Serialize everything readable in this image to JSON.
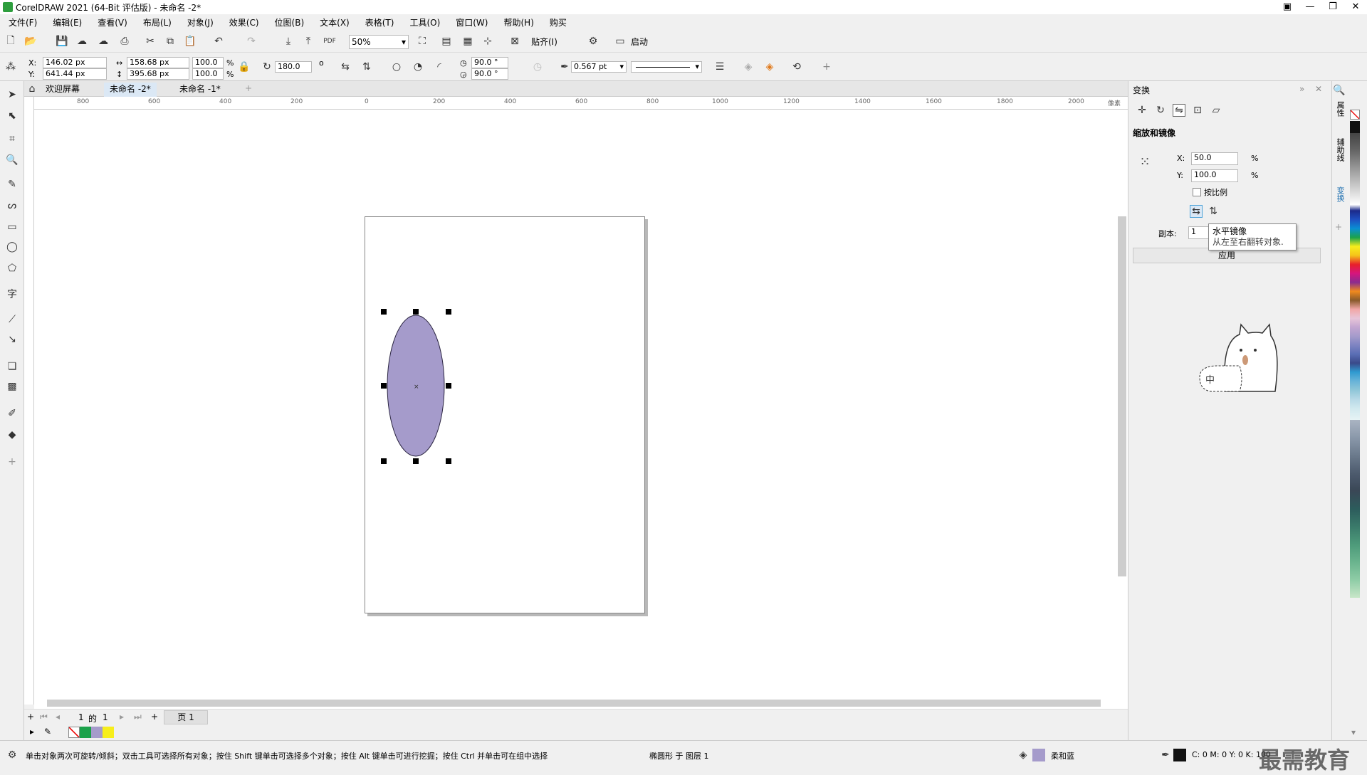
{
  "window": {
    "title": "CorelDRAW 2021 (64-Bit 评估版) - 未命名 -2*"
  },
  "menu": [
    "文件(F)",
    "编辑(E)",
    "查看(V)",
    "布局(L)",
    "对象(J)",
    "效果(C)",
    "位图(B)",
    "文本(X)",
    "表格(T)",
    "工具(O)",
    "窗口(W)",
    "帮助(H)",
    "购买"
  ],
  "toolbar": {
    "zoom": "50%",
    "snap": "贴齐(I)",
    "launch": "启动"
  },
  "props": {
    "x": "146.02 px",
    "y": "641.44 px",
    "w": "158.68 px",
    "h": "395.68 px",
    "sx": "100.0",
    "sy": "100.0",
    "pct": "%",
    "rot": "180.0",
    "deg": "o",
    "ang1": "90.0 °",
    "ang2": "90.0 °",
    "outline": "0.567 pt"
  },
  "tabs": {
    "welcome": "欢迎屏幕",
    "doc2": "未命名 -2*",
    "doc1": "未命名 -1*"
  },
  "ruler": {
    "ticks": [
      "800",
      "600",
      "400",
      "200",
      "0",
      "200",
      "400",
      "600",
      "800",
      "1000",
      "1200",
      "1400",
      "1600",
      "1800",
      "2000"
    ],
    "unit": "像素"
  },
  "pagebar": {
    "current": "1",
    "of": "的",
    "total": "1",
    "page_tab": "页 1"
  },
  "docker": {
    "title": "变换",
    "section": "缩放和镜像",
    "x_label": "X:",
    "x_value": "50.0",
    "y_label": "Y:",
    "y_value": "100.0",
    "pct": "%",
    "proportional": "按比例",
    "copies_label": "副本:",
    "copies_value": "1",
    "apply": "应用",
    "tooltip_title": "水平镜像",
    "tooltip_desc": "从左至右翻转对象."
  },
  "docktabs": {
    "props": "属性",
    "guides": "辅助线",
    "transform": "变换"
  },
  "status": {
    "hint": "单击对象两次可旋转/倾斜；双击工具可选择所有对象；按住 Shift 键单击可选择多个对象；按住 Alt 键单击可进行挖掘；按住 Ctrl 并单击可在组中选择",
    "object": "椭圆形 于 图层 1",
    "fill_name": "柔和蓝",
    "cmyk": "C: 0 M: 0 Y: 0 K: 100"
  },
  "watermark": "最需教育",
  "colors": {
    "ellipse": "#a59bcb",
    "accent": "#4da3d9"
  }
}
